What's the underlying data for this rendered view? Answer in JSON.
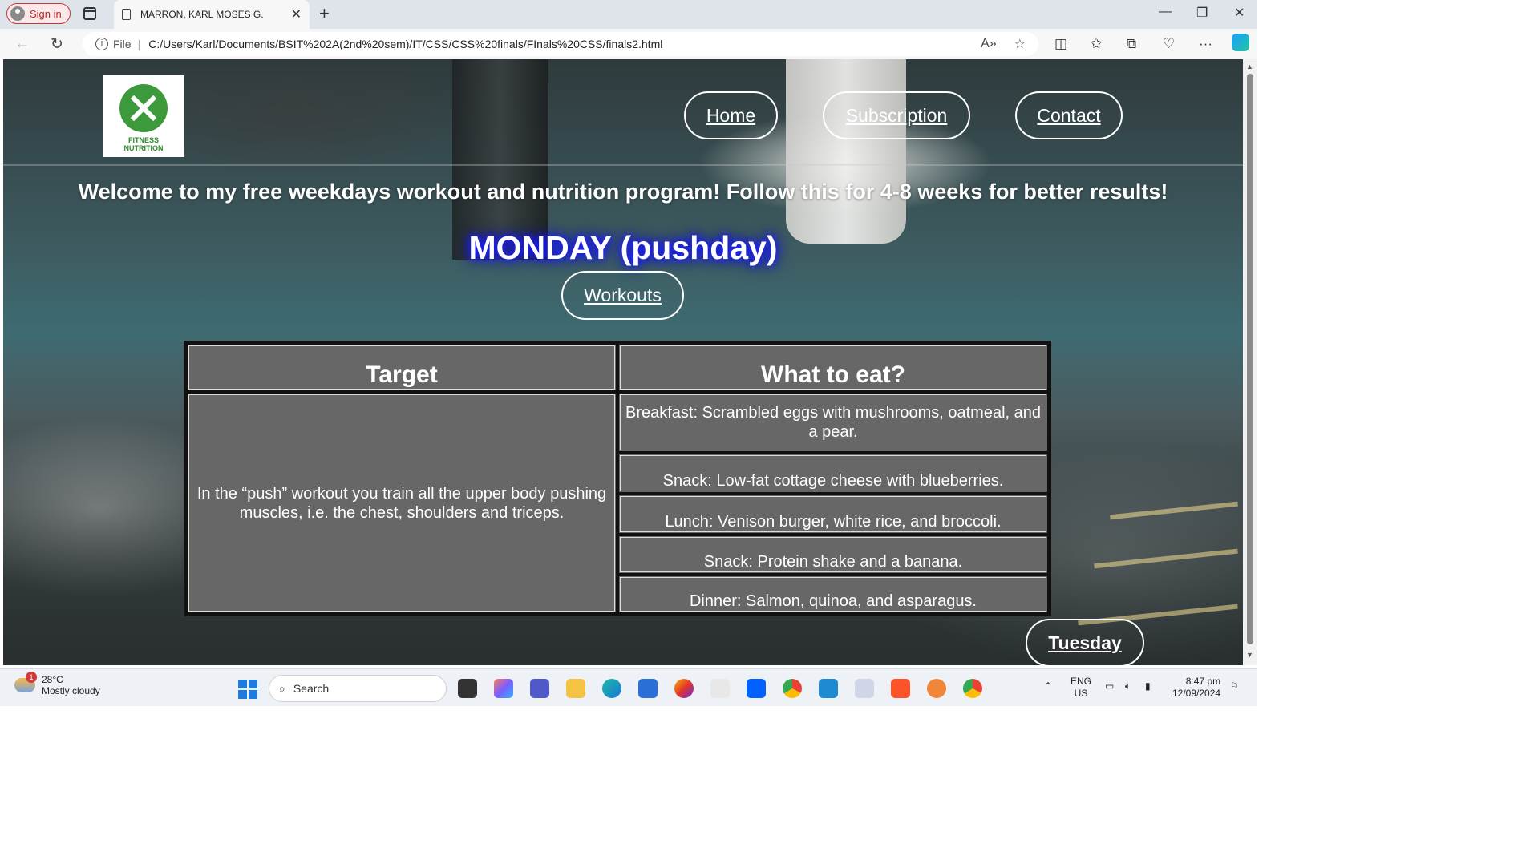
{
  "browser": {
    "signin_label": "Sign in",
    "tab_title": "MARRON, KARL MOSES G.",
    "address": {
      "prefix": "File",
      "url": "C:/Users/Karl/Documents/BSIT%202A(2nd%20sem)/IT/CSS/CSS%20finals/FInals%20CSS/finals2.html"
    }
  },
  "page": {
    "logo": {
      "line1": "FITNESS",
      "line2": "NUTRITION"
    },
    "nav": [
      {
        "label": "Home"
      },
      {
        "label": "Subscription"
      },
      {
        "label": "Contact"
      }
    ],
    "welcome": "Welcome to my free weekdays workout and nutrition program! Follow this for 4-8 weeks for better results!",
    "day_heading": "MONDAY (pushday)",
    "workouts_label": "Workouts",
    "table": {
      "headers": [
        "Target",
        "What to eat?"
      ],
      "target_text": "In the “push” workout you train all the upper body pushing muscles, i.e. the chest, shoulders and triceps.",
      "meals": [
        "Breakfast: Scrambled eggs with mushrooms, oatmeal, and a pear.",
        "Snack: Low-fat cottage cheese with blueberries.",
        "Lunch: Venison burger, white rice, and broccoli.",
        "Snack: Protein shake and a banana.",
        "Dinner: Salmon, quinoa, and asparagus."
      ]
    },
    "next_day_label": "Tuesday"
  },
  "taskbar": {
    "weather": {
      "temp": "28°C",
      "condition": "Mostly cloudy",
      "badge": "1"
    },
    "search_placeholder": "Search",
    "lang": {
      "line1": "ENG",
      "line2": "US"
    },
    "clock": {
      "time": "8:47 pm",
      "date": "12/09/2024"
    }
  },
  "colors": {
    "table_cell": "#676767",
    "heading_glow": "#2020ff",
    "taskbar": "#eef1f6"
  }
}
